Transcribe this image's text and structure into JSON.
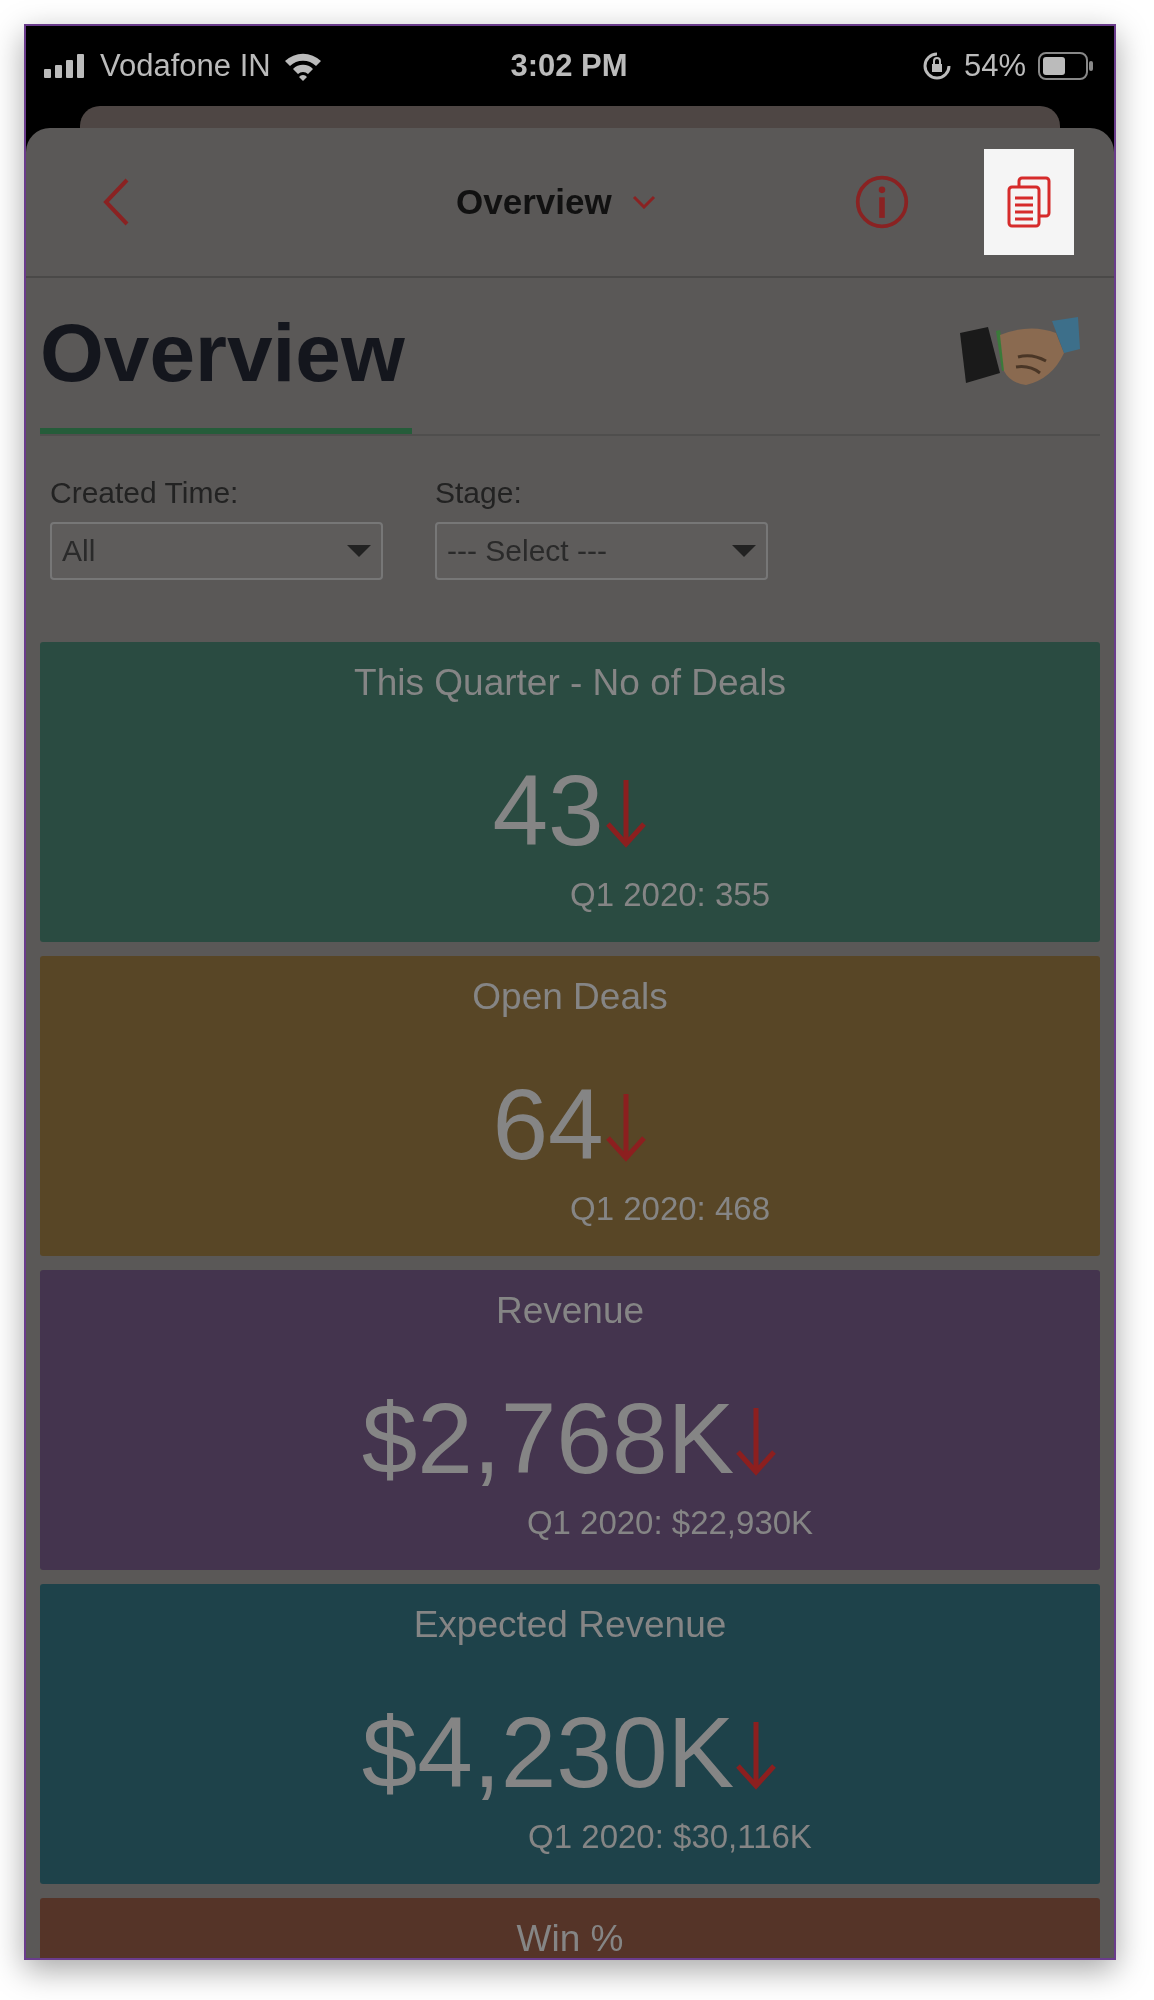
{
  "status_bar": {
    "carrier": "Vodafone IN",
    "time": "3:02 PM",
    "battery": "54%"
  },
  "header": {
    "title": "Overview",
    "copy_button": {
      "highlighted": true
    }
  },
  "page_title": "Overview",
  "filters": [
    {
      "label": "Created Time:",
      "value": "All"
    },
    {
      "label": "Stage:",
      "value": "--- Select ---"
    }
  ],
  "cards": [
    {
      "title": "This Quarter - No of Deals",
      "value": "43",
      "kind": "down",
      "comparison": "Q1 2020: 355",
      "color": "#2a4b41"
    },
    {
      "title": "Open Deals",
      "value": "64",
      "kind": "down",
      "comparison": "Q1 2020: 468",
      "color": "#584626"
    },
    {
      "title": "Revenue",
      "value": "$2,768K",
      "kind": "down",
      "comparison": "Q1 2020: $22,930K",
      "color": "#44344e"
    },
    {
      "title": "Expected Revenue",
      "value": "$4,230K",
      "kind": "down",
      "comparison": "Q1 2020: $30,116K",
      "color": "#1e424a"
    },
    {
      "title": "Win %",
      "color": "#553428"
    }
  ]
}
